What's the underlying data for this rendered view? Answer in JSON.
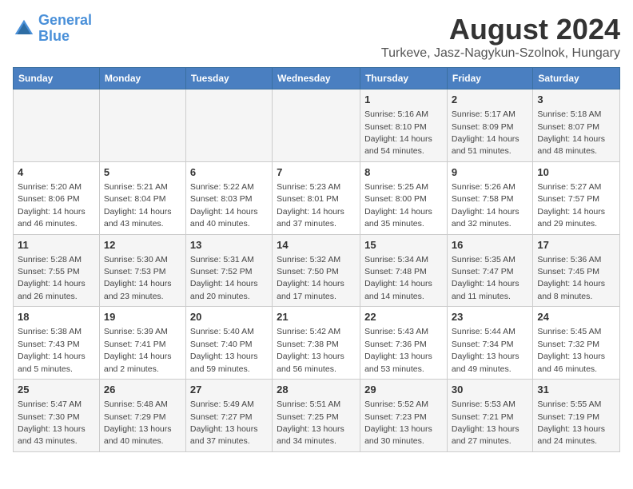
{
  "header": {
    "logo_line1": "General",
    "logo_line2": "Blue",
    "main_title": "August 2024",
    "sub_title": "Turkeve, Jasz-Nagykun-Szolnok, Hungary"
  },
  "days_of_week": [
    "Sunday",
    "Monday",
    "Tuesday",
    "Wednesday",
    "Thursday",
    "Friday",
    "Saturday"
  ],
  "weeks": [
    [
      {
        "day": "",
        "text": ""
      },
      {
        "day": "",
        "text": ""
      },
      {
        "day": "",
        "text": ""
      },
      {
        "day": "",
        "text": ""
      },
      {
        "day": "1",
        "text": "Sunrise: 5:16 AM\nSunset: 8:10 PM\nDaylight: 14 hours\nand 54 minutes."
      },
      {
        "day": "2",
        "text": "Sunrise: 5:17 AM\nSunset: 8:09 PM\nDaylight: 14 hours\nand 51 minutes."
      },
      {
        "day": "3",
        "text": "Sunrise: 5:18 AM\nSunset: 8:07 PM\nDaylight: 14 hours\nand 48 minutes."
      }
    ],
    [
      {
        "day": "4",
        "text": "Sunrise: 5:20 AM\nSunset: 8:06 PM\nDaylight: 14 hours\nand 46 minutes."
      },
      {
        "day": "5",
        "text": "Sunrise: 5:21 AM\nSunset: 8:04 PM\nDaylight: 14 hours\nand 43 minutes."
      },
      {
        "day": "6",
        "text": "Sunrise: 5:22 AM\nSunset: 8:03 PM\nDaylight: 14 hours\nand 40 minutes."
      },
      {
        "day": "7",
        "text": "Sunrise: 5:23 AM\nSunset: 8:01 PM\nDaylight: 14 hours\nand 37 minutes."
      },
      {
        "day": "8",
        "text": "Sunrise: 5:25 AM\nSunset: 8:00 PM\nDaylight: 14 hours\nand 35 minutes."
      },
      {
        "day": "9",
        "text": "Sunrise: 5:26 AM\nSunset: 7:58 PM\nDaylight: 14 hours\nand 32 minutes."
      },
      {
        "day": "10",
        "text": "Sunrise: 5:27 AM\nSunset: 7:57 PM\nDaylight: 14 hours\nand 29 minutes."
      }
    ],
    [
      {
        "day": "11",
        "text": "Sunrise: 5:28 AM\nSunset: 7:55 PM\nDaylight: 14 hours\nand 26 minutes."
      },
      {
        "day": "12",
        "text": "Sunrise: 5:30 AM\nSunset: 7:53 PM\nDaylight: 14 hours\nand 23 minutes."
      },
      {
        "day": "13",
        "text": "Sunrise: 5:31 AM\nSunset: 7:52 PM\nDaylight: 14 hours\nand 20 minutes."
      },
      {
        "day": "14",
        "text": "Sunrise: 5:32 AM\nSunset: 7:50 PM\nDaylight: 14 hours\nand 17 minutes."
      },
      {
        "day": "15",
        "text": "Sunrise: 5:34 AM\nSunset: 7:48 PM\nDaylight: 14 hours\nand 14 minutes."
      },
      {
        "day": "16",
        "text": "Sunrise: 5:35 AM\nSunset: 7:47 PM\nDaylight: 14 hours\nand 11 minutes."
      },
      {
        "day": "17",
        "text": "Sunrise: 5:36 AM\nSunset: 7:45 PM\nDaylight: 14 hours\nand 8 minutes."
      }
    ],
    [
      {
        "day": "18",
        "text": "Sunrise: 5:38 AM\nSunset: 7:43 PM\nDaylight: 14 hours\nand 5 minutes."
      },
      {
        "day": "19",
        "text": "Sunrise: 5:39 AM\nSunset: 7:41 PM\nDaylight: 14 hours\nand 2 minutes."
      },
      {
        "day": "20",
        "text": "Sunrise: 5:40 AM\nSunset: 7:40 PM\nDaylight: 13 hours\nand 59 minutes."
      },
      {
        "day": "21",
        "text": "Sunrise: 5:42 AM\nSunset: 7:38 PM\nDaylight: 13 hours\nand 56 minutes."
      },
      {
        "day": "22",
        "text": "Sunrise: 5:43 AM\nSunset: 7:36 PM\nDaylight: 13 hours\nand 53 minutes."
      },
      {
        "day": "23",
        "text": "Sunrise: 5:44 AM\nSunset: 7:34 PM\nDaylight: 13 hours\nand 49 minutes."
      },
      {
        "day": "24",
        "text": "Sunrise: 5:45 AM\nSunset: 7:32 PM\nDaylight: 13 hours\nand 46 minutes."
      }
    ],
    [
      {
        "day": "25",
        "text": "Sunrise: 5:47 AM\nSunset: 7:30 PM\nDaylight: 13 hours\nand 43 minutes."
      },
      {
        "day": "26",
        "text": "Sunrise: 5:48 AM\nSunset: 7:29 PM\nDaylight: 13 hours\nand 40 minutes."
      },
      {
        "day": "27",
        "text": "Sunrise: 5:49 AM\nSunset: 7:27 PM\nDaylight: 13 hours\nand 37 minutes."
      },
      {
        "day": "28",
        "text": "Sunrise: 5:51 AM\nSunset: 7:25 PM\nDaylight: 13 hours\nand 34 minutes."
      },
      {
        "day": "29",
        "text": "Sunrise: 5:52 AM\nSunset: 7:23 PM\nDaylight: 13 hours\nand 30 minutes."
      },
      {
        "day": "30",
        "text": "Sunrise: 5:53 AM\nSunset: 7:21 PM\nDaylight: 13 hours\nand 27 minutes."
      },
      {
        "day": "31",
        "text": "Sunrise: 5:55 AM\nSunset: 7:19 PM\nDaylight: 13 hours\nand 24 minutes."
      }
    ]
  ]
}
